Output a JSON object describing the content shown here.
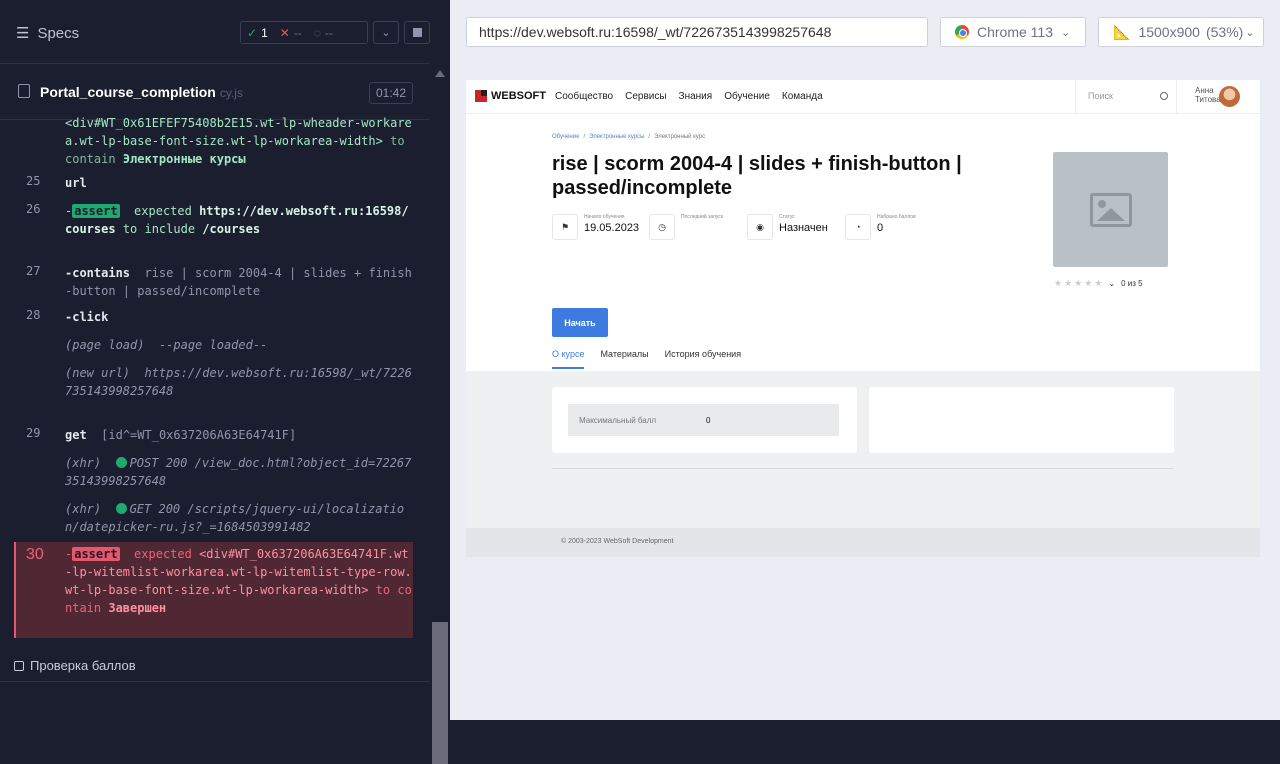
{
  "runner": {
    "specs_label": "Specs",
    "passed": "1",
    "failed": "--",
    "pending": "--",
    "spec_name": "Portal_course_completion",
    "spec_ext": "cy.js",
    "duration": "01:42",
    "suite_label": "Проверка баллов"
  },
  "log": {
    "r0_text": "<div#WT_0x61EFEF75408b2E15.wt-lp-wheader-workarea.wt-lp-base-font-size.wt-lp-workarea-width>",
    "r0_to": "to contain",
    "r0_val": "Электронные курсы",
    "r25_num": "25",
    "r25_cmd": "url",
    "r26_num": "26",
    "r26_tag": "assert",
    "r26_expected": "expected",
    "r26_url": "https://dev.websoft.ru:16598/courses",
    "r26_include": "to include",
    "r26_val": "/courses",
    "r27_num": "27",
    "r27_cmd": "-contains",
    "r27_arg": "rise | scorm 2004-4 | slides + finish-button | passed/incomplete",
    "r28_num": "28",
    "r28_cmd": "-click",
    "r_pageload": "(page load)",
    "r_pageload_msg": "--page loaded--",
    "r_newurl": "(new url)",
    "r_newurl_val": "https://dev.websoft.ru:16598/_wt/7226735143998257648",
    "r29_num": "29",
    "r29_cmd": "get",
    "r29_arg": "[id^=WT_0x637206A63E64741F]",
    "xhr1_tag": "(xhr)",
    "xhr1_msg": "POST 200 /view_doc.html?object_id=7226735143998257648",
    "xhr2_tag": "(xhr)",
    "xhr2_msg": "GET 200 /scripts/jquery-ui/localization/datepicker-ru.js?_=1684503991482",
    "r30_num": "30",
    "r30_tag": "assert",
    "r30_expected": "expected",
    "r30_el": "<div#WT_0x637206A63E64741F.wt-lp-witemlist-workarea.wt-lp-witemlist-type-row.wt-lp-base-font-size.wt-lp-workarea-width>",
    "r30_to": "to contain",
    "r30_val": "Завершен"
  },
  "browser": {
    "url": "https://dev.websoft.ru:16598/_wt/7226735143998257648",
    "browser_name": "Chrome 113",
    "viewport": "1500x900",
    "scale": "(53%)"
  },
  "site": {
    "logo": "WEBSOFT",
    "nav": [
      "Сообщество",
      "Сервисы",
      "Знания",
      "Обучение",
      "Команда"
    ],
    "search_placeholder": "Поиск",
    "user_first": "Анна",
    "user_last": "Титова",
    "crumbs": [
      "Обучение",
      "/",
      "Электронные курсы",
      "/",
      "Электронный курс"
    ],
    "title": "rise | scorm 2004-4 | slides + finish-button | passed/incomplete",
    "meta": [
      {
        "label": "Начало обучения",
        "value": "19.05.2023",
        "icon": "flag-icon"
      },
      {
        "label": "Последний запуск",
        "value": "",
        "icon": "clock-icon"
      },
      {
        "label": "Статус",
        "value": "Назначен",
        "icon": "check-circle-icon"
      },
      {
        "label": "Набрано баллов",
        "value": "0",
        "icon": "score-icon"
      }
    ],
    "rating_text": "0 из 5",
    "start_button": "Начать",
    "tabs": [
      "О курсе",
      "Материалы",
      "История обучения"
    ],
    "max_score_label": "Максимальный балл",
    "max_score_value": "0",
    "footer": "© 2003-2023 WebSoft Development"
  },
  "colors": {
    "pass": "#1fa971",
    "fail": "#e45770",
    "accent": "#3d7be0"
  }
}
